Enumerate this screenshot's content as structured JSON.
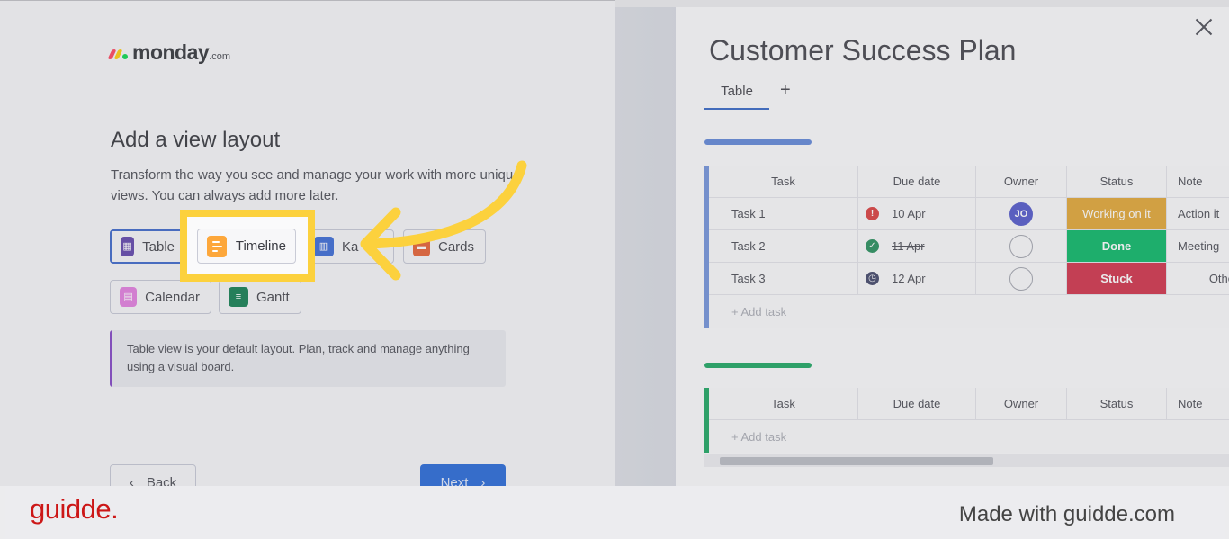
{
  "brand": {
    "name": "monday",
    "suffix": ".com",
    "colors": [
      "#ff3d57",
      "#ffcb00",
      "#00d647"
    ]
  },
  "onboarding": {
    "title": "Add a view layout",
    "description": "Transform the way you see and manage your work with more unique views. You can always add more later.",
    "views": [
      {
        "label": "Table",
        "icon": "table-icon",
        "color": "#5b3ea8",
        "selected": true
      },
      {
        "label": "Timeline",
        "icon": "timeline-icon",
        "color": "#fda73b"
      },
      {
        "label": "Ka",
        "icon": "kanban-icon",
        "color": "#3364d4"
      },
      {
        "label": "Cards",
        "icon": "cards-icon",
        "color": "#e55b2b"
      },
      {
        "label": "Calendar",
        "icon": "calendar-icon",
        "color": "#e279de"
      },
      {
        "label": "Gantt",
        "icon": "gantt-icon",
        "color": "#097a4a"
      }
    ],
    "info": "Table view is your default layout. Plan, track and manage anything using a visual board.",
    "back_label": "Back",
    "next_label": "Next"
  },
  "preview": {
    "title": "Customer Success Plan",
    "tab": "Table",
    "add_tab": "+",
    "columns": [
      "Task",
      "Due date",
      "Owner",
      "Status",
      "Note"
    ],
    "group1": {
      "color": "#5b82d6",
      "rows": [
        {
          "task": "Task 1",
          "due": "10 Apr",
          "due_icon": "alert-icon",
          "due_color": "#d93636",
          "owner": "JO",
          "status": "Working on it",
          "status_color": "#e0a32d",
          "note": "Action it"
        },
        {
          "task": "Task 2",
          "due": "11 Apr",
          "due_icon": "check-icon",
          "due_color": "#1f8a55",
          "owner": "",
          "status": "Done",
          "status_color": "#00b461",
          "note": "Meeting"
        },
        {
          "task": "Task 3",
          "due": "12 Apr",
          "due_icon": "clock-icon",
          "due_color": "#3a3f63",
          "owner": "",
          "status": "Stuck",
          "status_color": "#cf2a43",
          "note": "Othe"
        }
      ],
      "add_task": "+ Add task"
    },
    "group2": {
      "color": "#15a35c",
      "add_task": "+ Add task"
    }
  },
  "footer": {
    "logo": "guidde.",
    "tagline": "Made with guidde.com"
  }
}
